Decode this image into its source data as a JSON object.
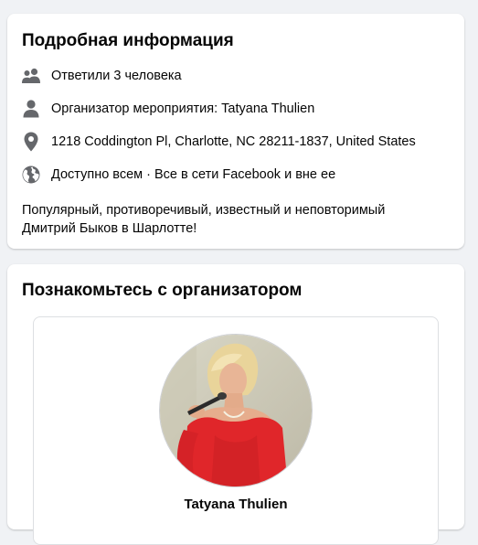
{
  "details": {
    "title": "Подробная информация",
    "responded": "Ответили 3 человека",
    "organizer_prefix": "Организатор мероприятия:",
    "organizer_name": "Tatyana Thulien",
    "address": "1218 Coddington Pl, Charlotte, NC 28211-1837, United States",
    "visibility": "Доступно всем · Все в сети Facebook и вне ее",
    "description": "Популярный, противоречивый, известный и неповторимый Дмитрий Быков в Шарлотте!"
  },
  "host": {
    "title": "Познакомьтесь с организатором",
    "name": "Tatyana Thulien"
  },
  "colors": {
    "background": "#f0f2f5",
    "card": "#ffffff",
    "icon": "#65676b",
    "avatar_dress": "#e0262a"
  },
  "icons": [
    "people-icon",
    "person-icon",
    "location-pin-icon",
    "globe-icon"
  ]
}
